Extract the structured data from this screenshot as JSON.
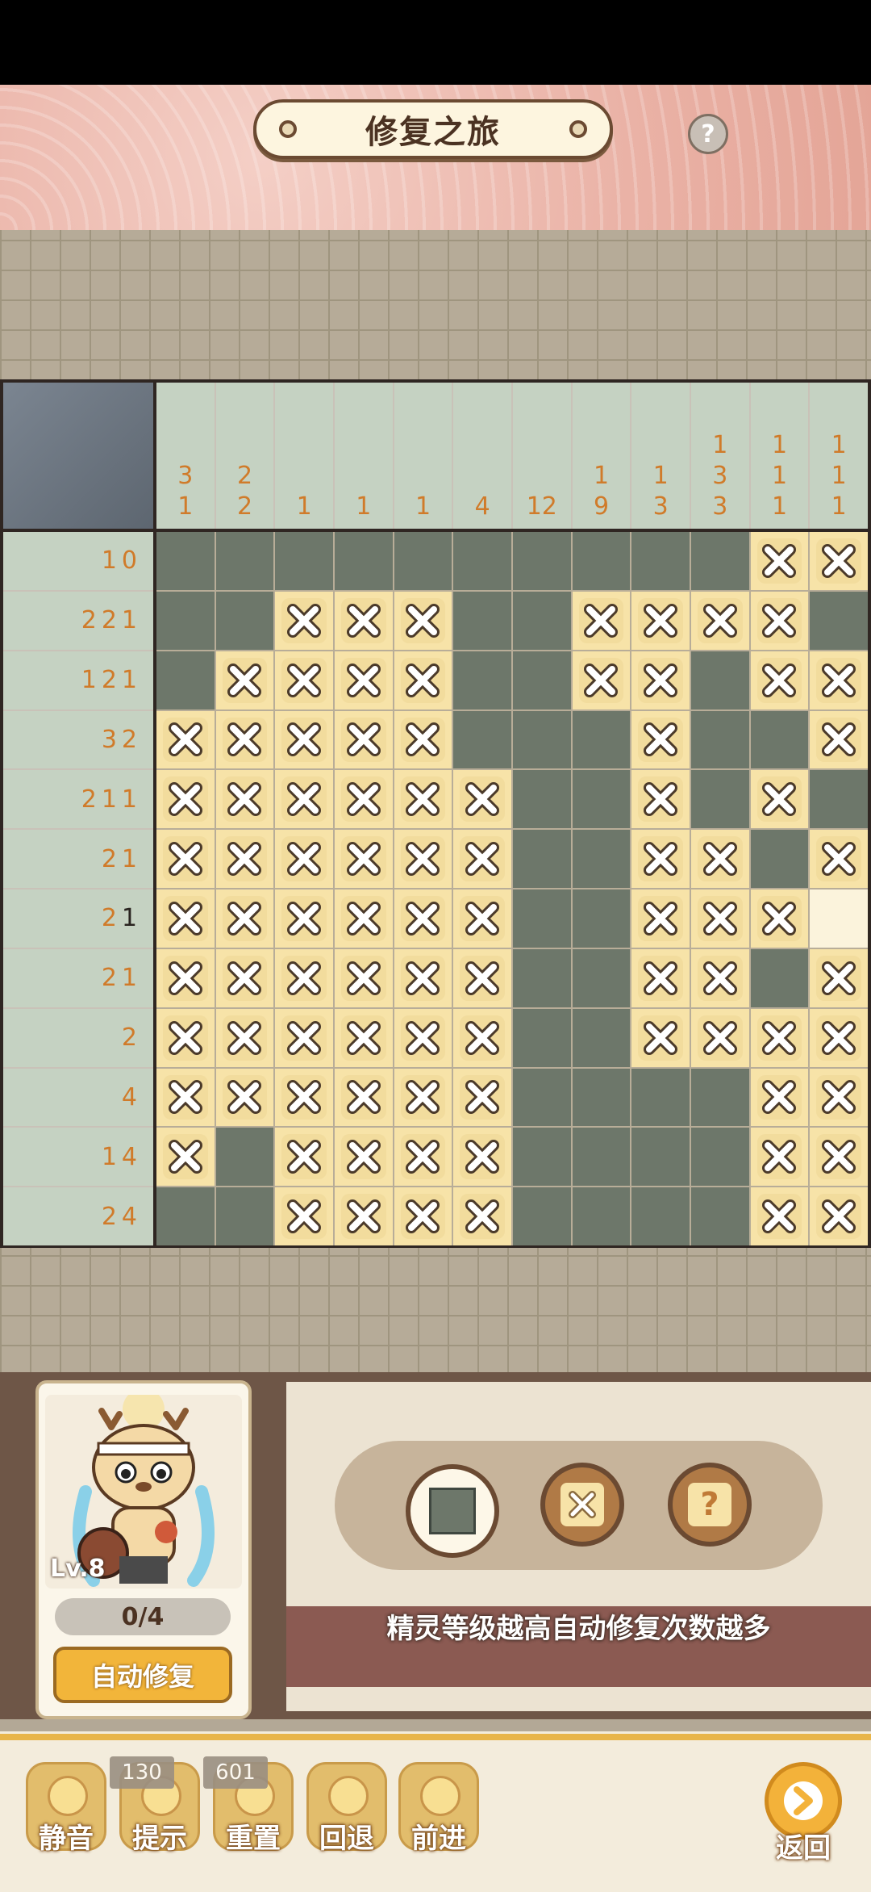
{
  "header": {
    "title": "修复之旅",
    "help": "?"
  },
  "puzzle": {
    "col_clues": [
      [
        "3",
        "1"
      ],
      [
        "2",
        "2"
      ],
      [
        "1"
      ],
      [
        "1"
      ],
      [
        "1"
      ],
      [
        "4"
      ],
      [
        "12"
      ],
      [
        "1",
        "9"
      ],
      [
        "1",
        "3"
      ],
      [
        "1",
        "3",
        "3"
      ],
      [
        "1",
        "1",
        "1"
      ],
      [
        "1",
        "1",
        "1"
      ]
    ],
    "row_clues": [
      "10",
      "221",
      "121",
      "32",
      "211",
      "21",
      "21",
      "21",
      "2",
      "4",
      "14",
      "24"
    ],
    "grid": [
      "ffffffffffxx",
      "ffxxxffxxxxf",
      "fxxxxffxxfxx",
      "xxxxxfffxffx",
      "xxxxxxffxfxf",
      "xxxxxxffxxfx",
      "xxxxxxffxxxe",
      "xxxxxxffxxfx",
      "xxxxxxffxxxx",
      "xxxxxxffffxx",
      "xfxxxxffffxx",
      "ffxxxxffffxx"
    ]
  },
  "tools": {
    "fill": "fill-tool",
    "cross": "cross-tool",
    "unknown": "?"
  },
  "hint_text": "精灵等级越高自动修复次数越多",
  "sprite": {
    "level": "Lv.8",
    "progress": "0/4",
    "auto_repair": "自动修复"
  },
  "footer": {
    "mute": "静音",
    "hint": "提示",
    "hint_count": "130",
    "reset": "重置",
    "reset_count": "601",
    "undo": "回退",
    "redo": "前进",
    "back": "返回"
  },
  "colors": {
    "filled": "#6d776a",
    "crossed": "#f7e3a8",
    "clue": "#d07b2a",
    "accent": "#f3b23a"
  }
}
